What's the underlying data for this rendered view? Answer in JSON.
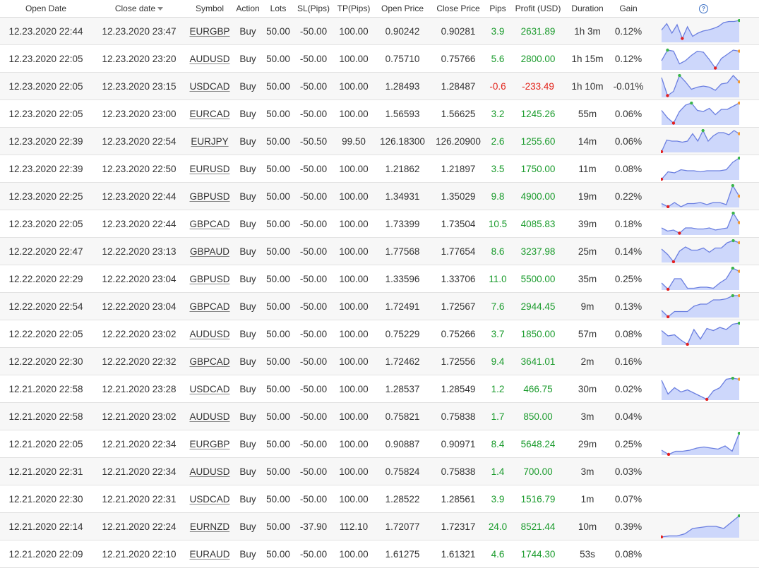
{
  "colors": {
    "positive": "#1a9b2c",
    "negative": "#e2231a",
    "spark_line": "#6b7fe0",
    "spark_fill": "#cdd7fb",
    "spark_max": "#3ab54a",
    "spark_min": "#e32020",
    "spark_last": "#f49a33"
  },
  "headers": {
    "open_date": "Open Date",
    "close_date": "Close date",
    "symbol": "Symbol",
    "action": "Action",
    "lots": "Lots",
    "sl": "SL(Pips)",
    "tp": "TP(Pips)",
    "open_price": "Open Price",
    "close_price": "Close Price",
    "pips": "Pips",
    "profit": "Profit (USD)",
    "duration": "Duration",
    "gain": "Gain",
    "help_icon": "?"
  },
  "rows": [
    {
      "open_date": "12.23.2020 22:44",
      "close_date": "12.23.2020 23:47",
      "symbol": "EURGBP",
      "action": "Buy",
      "lots": "50.00",
      "sl": "-50.00",
      "tp": "100.00",
      "open_price": "0.90242",
      "close_price": "0.90281",
      "pips": "3.9",
      "profit": "2631.89",
      "duration": "1h 3m",
      "gain": "0.12%",
      "spark": [
        0.45,
        0.15,
        0.6,
        0.2,
        0.85,
        0.3,
        0.75,
        0.6,
        0.5,
        0.45,
        0.38,
        0.28,
        0.1,
        0.05,
        0.05,
        0.0
      ]
    },
    {
      "open_date": "12.23.2020 22:05",
      "close_date": "12.23.2020 23:20",
      "symbol": "AUDUSD",
      "action": "Buy",
      "lots": "50.00",
      "sl": "-50.00",
      "tp": "100.00",
      "open_price": "0.75710",
      "close_price": "0.75766",
      "pips": "5.6",
      "profit": "2800.00",
      "duration": "1h 15m",
      "gain": "0.12%",
      "spark": [
        0.6,
        0.1,
        0.15,
        0.75,
        0.6,
        0.35,
        0.15,
        0.2,
        0.55,
        0.95,
        0.5,
        0.3,
        0.1,
        0.15
      ]
    },
    {
      "open_date": "12.23.2020 22:05",
      "close_date": "12.23.2020 23:15",
      "symbol": "USDCAD",
      "action": "Buy",
      "lots": "50.00",
      "sl": "-50.00",
      "tp": "100.00",
      "open_price": "1.28493",
      "close_price": "1.28487",
      "pips": "-0.6",
      "profit": "-233.49",
      "duration": "1h 10m",
      "gain": "-0.01%",
      "spark": [
        0.1,
        0.95,
        0.75,
        0.0,
        0.3,
        0.65,
        0.55,
        0.5,
        0.55,
        0.7,
        0.4,
        0.35,
        0.0,
        0.3
      ]
    },
    {
      "open_date": "12.23.2020 22:05",
      "close_date": "12.23.2020 23:00",
      "symbol": "EURCAD",
      "action": "Buy",
      "lots": "50.00",
      "sl": "-50.00",
      "tp": "100.00",
      "open_price": "1.56593",
      "close_price": "1.56625",
      "pips": "3.2",
      "profit": "1245.26",
      "duration": "55m",
      "gain": "0.06%",
      "spark": [
        0.35,
        0.7,
        0.95,
        0.4,
        0.1,
        0.0,
        0.35,
        0.4,
        0.25,
        0.55,
        0.3,
        0.3,
        0.15,
        0.0
      ]
    },
    {
      "open_date": "12.23.2020 22:39",
      "close_date": "12.23.2020 22:54",
      "symbol": "EURJPY",
      "action": "Buy",
      "lots": "50.00",
      "sl": "-50.50",
      "tp": "99.50",
      "open_price": "126.18300",
      "close_price": "126.20900",
      "pips": "2.6",
      "profit": "1255.60",
      "duration": "14m",
      "gain": "0.06%",
      "spark": [
        1.0,
        0.45,
        0.5,
        0.5,
        0.55,
        0.5,
        0.15,
        0.5,
        0.0,
        0.5,
        0.25,
        0.1,
        0.1,
        0.2,
        0.0,
        0.15
      ]
    },
    {
      "open_date": "12.23.2020 22:39",
      "close_date": "12.23.2020 22:50",
      "symbol": "EURUSD",
      "action": "Buy",
      "lots": "50.00",
      "sl": "-50.00",
      "tp": "100.00",
      "open_price": "1.21862",
      "close_price": "1.21897",
      "pips": "3.5",
      "profit": "1750.00",
      "duration": "11m",
      "gain": "0.08%",
      "spark": [
        1.0,
        0.65,
        0.7,
        0.55,
        0.6,
        0.6,
        0.65,
        0.6,
        0.6,
        0.6,
        0.55,
        0.2,
        0.0
      ]
    },
    {
      "open_date": "12.23.2020 22:25",
      "close_date": "12.23.2020 22:44",
      "symbol": "GBPUSD",
      "action": "Buy",
      "lots": "50.00",
      "sl": "-50.00",
      "tp": "100.00",
      "open_price": "1.34931",
      "close_price": "1.35029",
      "pips": "9.8",
      "profit": "4900.00",
      "duration": "19m",
      "gain": "0.22%",
      "spark": [
        0.85,
        1.0,
        0.8,
        1.0,
        0.85,
        0.85,
        0.8,
        0.9,
        0.8,
        0.8,
        0.9,
        0.0,
        0.5
      ]
    },
    {
      "open_date": "12.23.2020 22:05",
      "close_date": "12.23.2020 22:44",
      "symbol": "GBPCAD",
      "action": "Buy",
      "lots": "50.00",
      "sl": "-50.00",
      "tp": "100.00",
      "open_price": "1.73399",
      "close_price": "1.73504",
      "pips": "10.5",
      "profit": "4085.83",
      "duration": "39m",
      "gain": "0.18%",
      "spark": [
        0.7,
        0.85,
        0.8,
        0.95,
        0.7,
        0.7,
        0.75,
        0.75,
        0.7,
        0.8,
        0.75,
        0.7,
        0.0,
        0.45
      ]
    },
    {
      "open_date": "12.22.2020 22:47",
      "close_date": "12.22.2020 23:13",
      "symbol": "GBPAUD",
      "action": "Buy",
      "lots": "50.00",
      "sl": "-50.00",
      "tp": "100.00",
      "open_price": "1.77568",
      "close_price": "1.77654",
      "pips": "8.6",
      "profit": "3237.98",
      "duration": "25m",
      "gain": "0.14%",
      "spark": [
        0.4,
        0.65,
        1.0,
        0.5,
        0.3,
        0.45,
        0.45,
        0.35,
        0.55,
        0.35,
        0.35,
        0.1,
        0.0,
        0.1
      ]
    },
    {
      "open_date": "12.22.2020 22:29",
      "close_date": "12.22.2020 23:04",
      "symbol": "GBPUSD",
      "action": "Buy",
      "lots": "50.00",
      "sl": "-50.00",
      "tp": "100.00",
      "open_price": "1.33596",
      "close_price": "1.33706",
      "pips": "11.0",
      "profit": "5500.00",
      "duration": "35m",
      "gain": "0.25%",
      "spark": [
        0.7,
        1.0,
        0.5,
        0.5,
        0.95,
        0.95,
        0.9,
        0.9,
        0.95,
        0.7,
        0.5,
        0.0,
        0.15
      ]
    },
    {
      "open_date": "12.22.2020 22:54",
      "close_date": "12.22.2020 23:04",
      "symbol": "GBPCAD",
      "action": "Buy",
      "lots": "50.00",
      "sl": "-50.00",
      "tp": "100.00",
      "open_price": "1.72491",
      "close_price": "1.72567",
      "pips": "7.6",
      "profit": "2944.45",
      "duration": "9m",
      "gain": "0.13%",
      "spark": [
        0.7,
        1.0,
        0.75,
        0.75,
        0.75,
        0.5,
        0.4,
        0.4,
        0.2,
        0.2,
        0.15,
        0.0,
        0.0
      ]
    },
    {
      "open_date": "12.22.2020 22:05",
      "close_date": "12.22.2020 23:02",
      "symbol": "AUDUSD",
      "action": "Buy",
      "lots": "50.00",
      "sl": "-50.00",
      "tp": "100.00",
      "open_price": "0.75229",
      "close_price": "0.75266",
      "pips": "3.7",
      "profit": "1850.00",
      "duration": "57m",
      "gain": "0.08%",
      "spark": [
        0.35,
        0.6,
        0.55,
        0.8,
        1.0,
        0.3,
        0.75,
        0.25,
        0.35,
        0.2,
        0.3,
        0.05,
        0.0
      ]
    },
    {
      "open_date": "12.22.2020 22:30",
      "close_date": "12.22.2020 22:32",
      "symbol": "GBPCAD",
      "action": "Buy",
      "lots": "50.00",
      "sl": "-50.00",
      "tp": "100.00",
      "open_price": "1.72462",
      "close_price": "1.72556",
      "pips": "9.4",
      "profit": "3641.01",
      "duration": "2m",
      "gain": "0.16%",
      "spark": []
    },
    {
      "open_date": "12.21.2020 22:58",
      "close_date": "12.21.2020 23:28",
      "symbol": "USDCAD",
      "action": "Buy",
      "lots": "50.00",
      "sl": "-50.00",
      "tp": "100.00",
      "open_price": "1.28537",
      "close_price": "1.28549",
      "pips": "1.2",
      "profit": "466.75",
      "duration": "30m",
      "gain": "0.02%",
      "spark": [
        0.1,
        0.75,
        0.45,
        0.65,
        0.55,
        0.7,
        0.85,
        1.0,
        0.6,
        0.45,
        0.05,
        0.0,
        0.05
      ]
    },
    {
      "open_date": "12.21.2020 22:58",
      "close_date": "12.21.2020 23:02",
      "symbol": "AUDUSD",
      "action": "Buy",
      "lots": "50.00",
      "sl": "-50.00",
      "tp": "100.00",
      "open_price": "0.75821",
      "close_price": "0.75838",
      "pips": "1.7",
      "profit": "850.00",
      "duration": "3m",
      "gain": "0.04%",
      "spark": []
    },
    {
      "open_date": "12.21.2020 22:05",
      "close_date": "12.21.2020 22:34",
      "symbol": "EURGBP",
      "action": "Buy",
      "lots": "50.00",
      "sl": "-50.00",
      "tp": "100.00",
      "open_price": "0.90887",
      "close_price": "0.90971",
      "pips": "8.4",
      "profit": "5648.24",
      "duration": "29m",
      "gain": "0.25%",
      "spark": [
        0.8,
        1.0,
        0.85,
        0.85,
        0.8,
        0.7,
        0.65,
        0.7,
        0.75,
        0.6,
        0.85,
        0.0
      ]
    },
    {
      "open_date": "12.21.2020 22:31",
      "close_date": "12.21.2020 22:34",
      "symbol": "AUDUSD",
      "action": "Buy",
      "lots": "50.00",
      "sl": "-50.00",
      "tp": "100.00",
      "open_price": "0.75824",
      "close_price": "0.75838",
      "pips": "1.4",
      "profit": "700.00",
      "duration": "3m",
      "gain": "0.03%",
      "spark": []
    },
    {
      "open_date": "12.21.2020 22:30",
      "close_date": "12.21.2020 22:31",
      "symbol": "USDCAD",
      "action": "Buy",
      "lots": "50.00",
      "sl": "-50.00",
      "tp": "100.00",
      "open_price": "1.28522",
      "close_price": "1.28561",
      "pips": "3.9",
      "profit": "1516.79",
      "duration": "1m",
      "gain": "0.07%",
      "spark": []
    },
    {
      "open_date": "12.21.2020 22:14",
      "close_date": "12.21.2020 22:24",
      "symbol": "EURNZD",
      "action": "Buy",
      "lots": "50.00",
      "sl": "-37.90",
      "tp": "112.10",
      "open_price": "1.72077",
      "close_price": "1.72317",
      "pips": "24.0",
      "profit": "8521.44",
      "duration": "10m",
      "gain": "0.39%",
      "spark": [
        1.0,
        0.95,
        0.95,
        0.85,
        0.6,
        0.55,
        0.5,
        0.5,
        0.6,
        0.3,
        0.0
      ]
    },
    {
      "open_date": "12.21.2020 22:09",
      "close_date": "12.21.2020 22:10",
      "symbol": "EURAUD",
      "action": "Buy",
      "lots": "50.00",
      "sl": "-50.00",
      "tp": "100.00",
      "open_price": "1.61275",
      "close_price": "1.61321",
      "pips": "4.6",
      "profit": "1744.30",
      "duration": "53s",
      "gain": "0.08%",
      "spark": []
    }
  ]
}
